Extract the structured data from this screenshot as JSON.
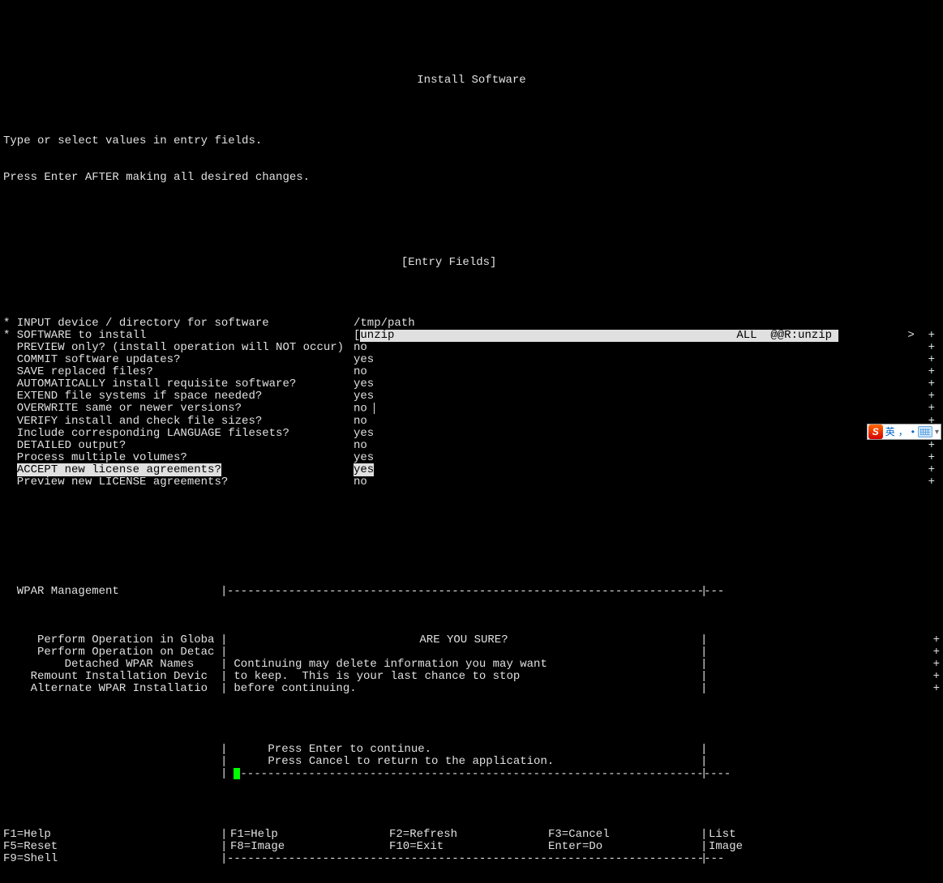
{
  "title": "Install Software",
  "instructions": [
    "Type or select values in entry fields.",
    "Press Enter AFTER making all desired changes."
  ],
  "entry_fields_header": "[Entry Fields]",
  "fields": [
    {
      "label": "* INPUT device / directory for software",
      "value": "/tmp/path",
      "prefix": "",
      "plus": false,
      "hl": false
    },
    {
      "label": "* SOFTWARE to install",
      "value": "unzip",
      "right": "ALL  @@R:unzip",
      "prefix": "[",
      "plus": true,
      "hl": true,
      "caret": true
    },
    {
      "label": "  PREVIEW only? (install operation will NOT occur)",
      "value": "no",
      "plus": true
    },
    {
      "label": "  COMMIT software updates?",
      "value": "yes",
      "plus": true
    },
    {
      "label": "  SAVE replaced files?",
      "value": "no",
      "plus": true
    },
    {
      "label": "  AUTOMATICALLY install requisite software?",
      "value": "yes",
      "plus": true
    },
    {
      "label": "  EXTEND file systems if space needed?",
      "value": "yes",
      "plus": true
    },
    {
      "label": "  OVERWRITE same or newer versions?",
      "value": "no",
      "plus": true,
      "cursor": true
    },
    {
      "label": "  VERIFY install and check file sizes?",
      "value": "no",
      "plus": true
    },
    {
      "label": "  Include corresponding LANGUAGE filesets?",
      "value": "yes",
      "plus": true
    },
    {
      "label": "  DETAILED output?",
      "value": "no",
      "plus": true
    },
    {
      "label": "  Process multiple volumes?",
      "value": "yes",
      "plus": true
    },
    {
      "label": "  ACCEPT new license agreements?",
      "value": "yes",
      "plus": true,
      "labelhl": true,
      "valuehl": true
    },
    {
      "label": "  Preview new LICENSE agreements?",
      "value": "no",
      "plus": true
    }
  ],
  "wpar_header": "  WPAR Management",
  "wpar_items": [
    "     Perform Operation in Globa",
    "     Perform Operation on Detac",
    "         Detached WPAR Names",
    "    Remount Installation Devic",
    "    Alternate WPAR Installatio"
  ],
  "wpar_plus": [
    "+",
    "+",
    "+",
    "+",
    "+"
  ],
  "dialog": {
    "title": "ARE YOU SURE?",
    "lines": [
      "Continuing may delete information you may want",
      "to keep.  This is your last chance to stop",
      "before continuing.",
      "     Press Enter to continue.",
      "     Press Cancel to return to the application."
    ],
    "fkeys_dialog": [
      [
        "F1=Help",
        "F2=Refresh",
        "F3=Cancel"
      ],
      [
        "F8=Image",
        "F10=Exit",
        "Enter=Do"
      ]
    ]
  },
  "fkeys_left": [
    "F1=Help",
    "F5=Reset",
    "F9=Shell"
  ],
  "fkeys_right": [
    "List",
    "Image",
    ""
  ],
  "ime": {
    "s": "S",
    "lang": "英",
    "punct": "，",
    "full": "•"
  }
}
